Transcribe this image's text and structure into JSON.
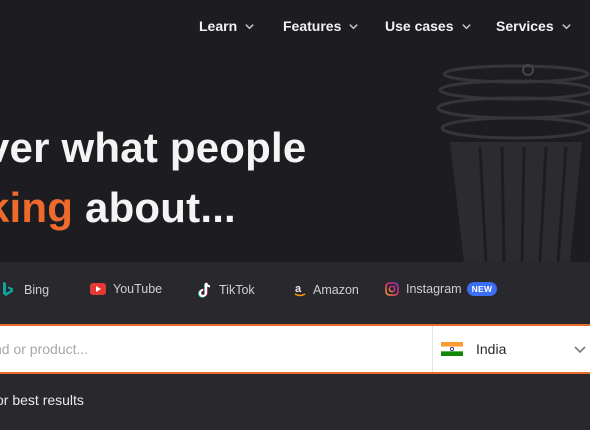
{
  "nav": {
    "items": [
      {
        "label": "Learn"
      },
      {
        "label": "Features"
      },
      {
        "label": "Use cases"
      },
      {
        "label": "Services"
      }
    ]
  },
  "hero": {
    "line1": "ver what people",
    "line2_accent": "king",
    "line2_rest": " about..."
  },
  "sources": {
    "tabs": [
      {
        "label": "Bing",
        "icon": "bing-icon"
      },
      {
        "label": "YouTube",
        "icon": "youtube-icon"
      },
      {
        "label": "TikTok",
        "icon": "tiktok-icon"
      },
      {
        "label": "Amazon",
        "icon": "amazon-icon"
      },
      {
        "label": "Instagram",
        "icon": "instagram-icon",
        "badge": "NEW"
      }
    ]
  },
  "search": {
    "placeholder": "nd or product..."
  },
  "country": {
    "selected": "India",
    "flag": "india-flag"
  },
  "hint": "or best results",
  "colors": {
    "accent": "#f06a2d",
    "background": "#1d1d21",
    "panel": "#29292d",
    "badge": "#3b6ef5"
  }
}
